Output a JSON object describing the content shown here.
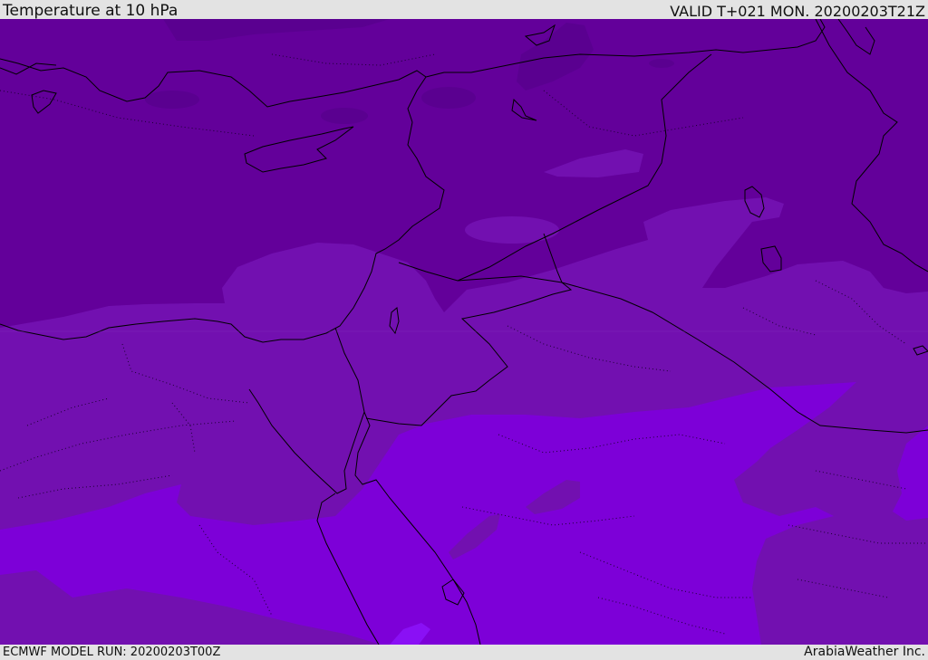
{
  "header": {
    "title": "Temperature at 10 hPa",
    "valid": "VALID T+021 MON. 20200203T21Z"
  },
  "footer": {
    "model_run": "ECMWF MODEL RUN: 20200203T00Z",
    "credit": "ArabiaWeather Inc."
  },
  "colors": {
    "darkest": "#5a0090",
    "dark": "#63009a",
    "mid": "#7210b0",
    "light": "#7d00d8",
    "lightest": "#8a10f5",
    "border": "#000000"
  }
}
